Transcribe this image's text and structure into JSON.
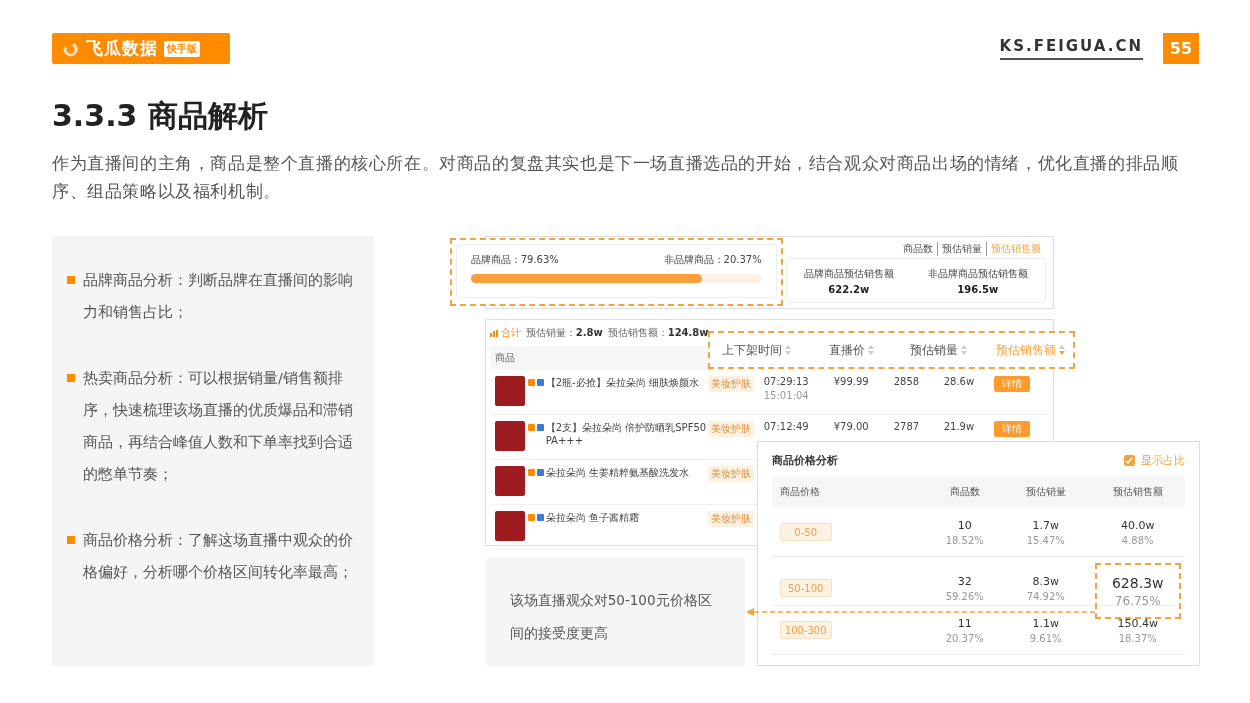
{
  "header": {
    "logo_text": "飞瓜数据",
    "logo_badge": "快手版",
    "site": "KS.FEIGUA.CN",
    "page_number": "55"
  },
  "title": "3.3.3 商品解析",
  "intro": "作为直播间的主角，商品是整个直播的核心所在。对商品的复盘其实也是下一场直播选品的开始，结合观众对商品出场的情绪，优化直播的排品顺序、组品策略以及福利机制。",
  "bullets": [
    "品牌商品分析：判断品牌在直播间的影响力和销售占比；",
    "热卖商品分析：可以根据销量/销售额排序，快速梳理该场直播的优质爆品和滞销商品，再结合峰值人数和下单率找到合适的憋单节奏；",
    "商品价格分析：了解这场直播中观众的价格偏好，分析哪个价格区间转化率最高；"
  ],
  "brand_panel": {
    "brand_label": "品牌商品：79.63%",
    "non_brand_label": "非品牌商品：20.37%",
    "level": 0.7963,
    "tabs": [
      {
        "label": "商品数",
        "selected": false
      },
      {
        "label": "预估销量",
        "selected": false
      },
      {
        "label": "预估销售额",
        "selected": true
      }
    ],
    "stats": [
      {
        "label": "品牌商品预估销售额",
        "value": "622.2w"
      },
      {
        "label": "非品牌商品预估销售额",
        "value": "196.5w"
      }
    ]
  },
  "product_table": {
    "summary_label": "合计",
    "summary": [
      {
        "label": "预估销量：",
        "value": "2.8w"
      },
      {
        "label": "预估销售额：",
        "value": "124.8w"
      }
    ],
    "product_column": "商品",
    "sort_columns": [
      {
        "label": "上下架时间",
        "sorted": false
      },
      {
        "label": "直播价",
        "sorted": false
      },
      {
        "label": "预估销量",
        "sorted": false
      },
      {
        "label": "预估销售额",
        "sorted": true
      }
    ],
    "rows": [
      {
        "name": "【2瓶-必抢】朵拉朵尚 细肤焕颜水",
        "tag": "美妆护肤",
        "time_on": "07:29:13",
        "time_off": "15:01:04",
        "price": "¥99.99",
        "sales": "2858",
        "revenue": "28.6w",
        "action": "详情"
      },
      {
        "name": "【2支】朵拉朵尚 倍护防晒乳SPF50 PA+++",
        "tag": "美妆护肤",
        "time_on": "07:12:49",
        "price": "¥79.00",
        "sales": "2787",
        "revenue": "21.9w",
        "action": "详情"
      },
      {
        "name": "朵拉朵尚 生姜精粹氨基酸洗发水",
        "tag": "美妆护肤"
      },
      {
        "name": "朵拉朵尚 鱼子酱精霜",
        "tag": "美妆护肤"
      }
    ]
  },
  "price_panel": {
    "title": "商品价格分析",
    "show_ratio": {
      "label": "显示占比",
      "checked": true
    },
    "columns": [
      "商品价格",
      "商品数",
      "预估销量",
      "预估销售额"
    ],
    "rows": [
      {
        "range": "0-50",
        "count": "10",
        "count_pct": "18.52%",
        "sales": "1.7w",
        "sales_pct": "15.47%",
        "revenue": "40.0w",
        "revenue_pct": "4.88%",
        "highlighted": false
      },
      {
        "range": "50-100",
        "count": "32",
        "count_pct": "59.26%",
        "sales": "8.3w",
        "sales_pct": "74.92%",
        "revenue": "628.3w",
        "revenue_pct": "76.75%",
        "highlighted": true
      },
      {
        "range": "100-300",
        "count": "11",
        "count_pct": "20.37%",
        "sales": "1.1w",
        "sales_pct": "9.61%",
        "revenue": "150.4w",
        "revenue_pct": "18.37%",
        "highlighted": false
      }
    ]
  },
  "callout": "该场直播观众对50-100元价格区间的接受度更高"
}
